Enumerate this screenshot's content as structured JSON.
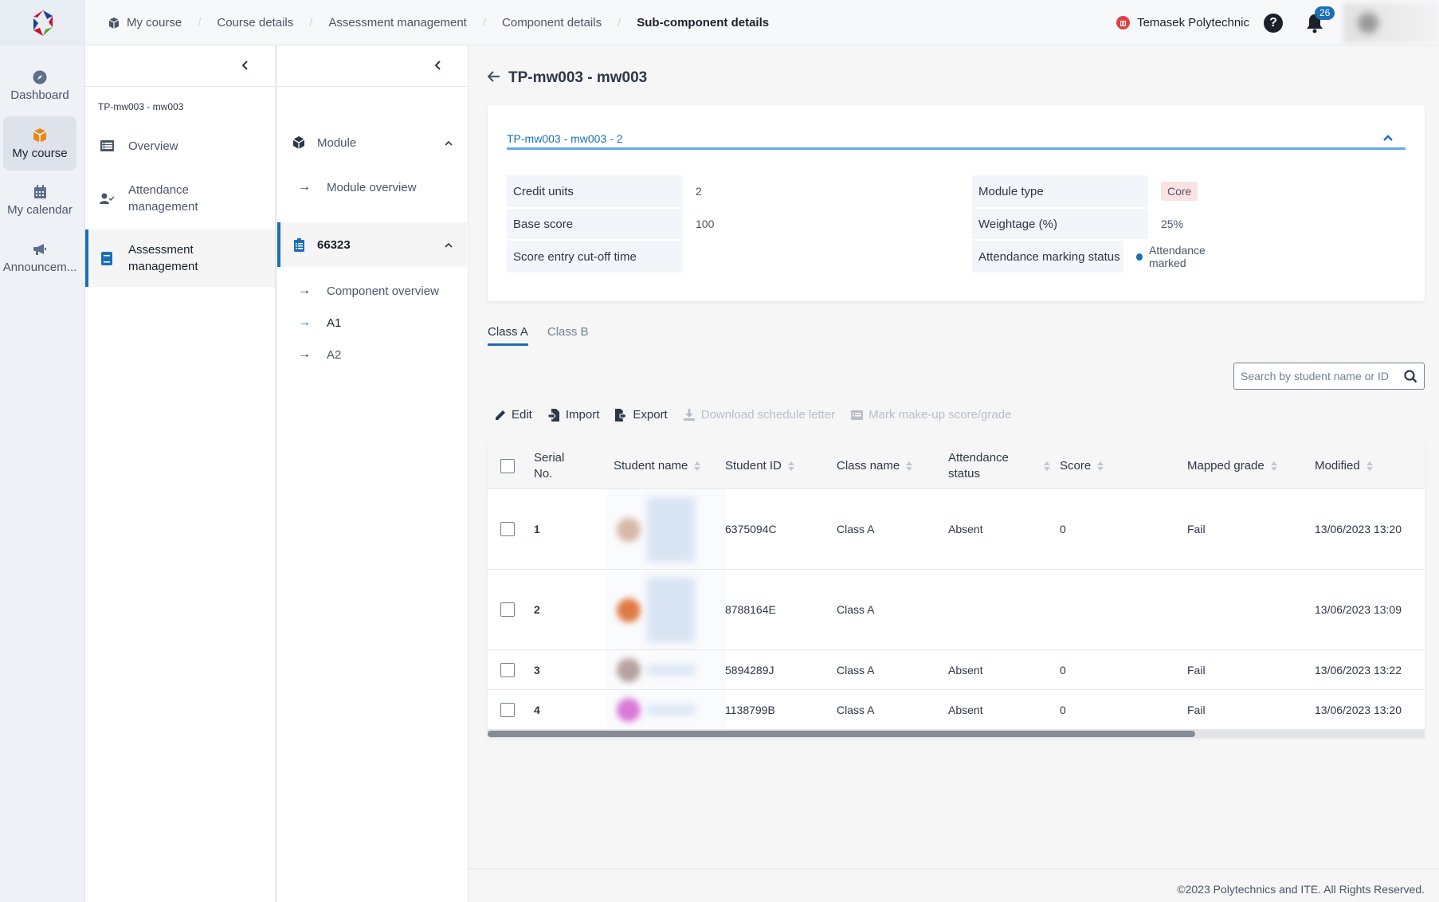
{
  "topbar": {
    "breadcrumb": [
      "My course",
      "Course details",
      "Assessment management",
      "Component details",
      "Sub-component details"
    ],
    "institution": "Temasek Polytechnic",
    "help_label": "?",
    "notification_count": "26"
  },
  "rail": {
    "items": [
      {
        "label": "Dashboard",
        "icon": "compass-icon",
        "active": false
      },
      {
        "label": "My course",
        "icon": "cube-icon",
        "active": true
      },
      {
        "label": "My calendar",
        "icon": "calendar-icon",
        "active": false
      },
      {
        "label": "Announcem...",
        "icon": "megaphone-icon",
        "active": false
      }
    ]
  },
  "panel2": {
    "course_code": "TP-mw003 - mw003",
    "items": [
      {
        "label": "Overview",
        "icon": "list-icon"
      },
      {
        "label": "Attendance management",
        "icon": "user-check-icon"
      },
      {
        "label": "Assessment management",
        "icon": "book-icon",
        "active": true
      }
    ]
  },
  "panel3": {
    "module_label": "Module",
    "module_overview": "Module overview",
    "component_label": "66323",
    "component_overview": "Component overview",
    "subcomponents": [
      "A1",
      "A2"
    ],
    "active_subcomponent": "A1"
  },
  "main": {
    "title": "TP-mw003 - mw003",
    "card": {
      "title": "TP-mw003 - mw003 - 2",
      "left": [
        {
          "label": "Credit units",
          "value": "2"
        },
        {
          "label": "Base score",
          "value": "100"
        },
        {
          "label": "Score entry cut-off time",
          "value": ""
        }
      ],
      "right": [
        {
          "label": "Module type",
          "value": "Core"
        },
        {
          "label": "Weightage (%)",
          "value": "25%"
        },
        {
          "label": "Attendance marking status",
          "value": "Attendance marked"
        }
      ]
    },
    "tabs": [
      {
        "label": "Class A",
        "active": true
      },
      {
        "label": "Class B",
        "active": false
      }
    ],
    "search": {
      "placeholder": "Search by student name or ID",
      "value": ""
    },
    "toolbar": [
      {
        "label": "Edit",
        "icon": "pencil-icon",
        "disabled": false
      },
      {
        "label": "Import",
        "icon": "import-icon",
        "disabled": false
      },
      {
        "label": "Export",
        "icon": "export-icon",
        "disabled": false
      },
      {
        "label": "Download schedule letter",
        "icon": "download-icon",
        "disabled": true
      },
      {
        "label": "Mark make-up score/grade",
        "icon": "list-alt-icon",
        "disabled": true
      }
    ],
    "table": {
      "columns": [
        "Serial No.",
        "Student name",
        "Student ID",
        "Class name",
        "Attendance status",
        "Score",
        "Mapped grade",
        "Modified"
      ],
      "rows": [
        {
          "serial": "1",
          "student_name": "",
          "student_id": "6375094C",
          "class_name": "Class A",
          "attendance": "Absent",
          "score": "0",
          "grade": "Fail",
          "modified": "13/06/2023 13:20"
        },
        {
          "serial": "2",
          "student_name": "",
          "student_id": "8788164E",
          "class_name": "Class A",
          "attendance": "",
          "score": "",
          "grade": "",
          "modified": "13/06/2023 13:09"
        },
        {
          "serial": "3",
          "student_name": "",
          "student_id": "5894289J",
          "class_name": "Class A",
          "attendance": "Absent",
          "score": "0",
          "grade": "Fail",
          "modified": "13/06/2023 13:22"
        },
        {
          "serial": "4",
          "student_name": "",
          "student_id": "1138799B",
          "class_name": "Class A",
          "attendance": "Absent",
          "score": "0",
          "grade": "Fail",
          "modified": "13/06/2023 13:20"
        }
      ]
    }
  },
  "footer": {
    "text": "©2023 Polytechnics and ITE. All Rights Reserved."
  },
  "colors": {
    "accent": "#1a6fb5",
    "core_tag_bg": "#fde2e2",
    "rail_active_bg": "#dde2eb",
    "card_underline": "#63a9ee"
  }
}
